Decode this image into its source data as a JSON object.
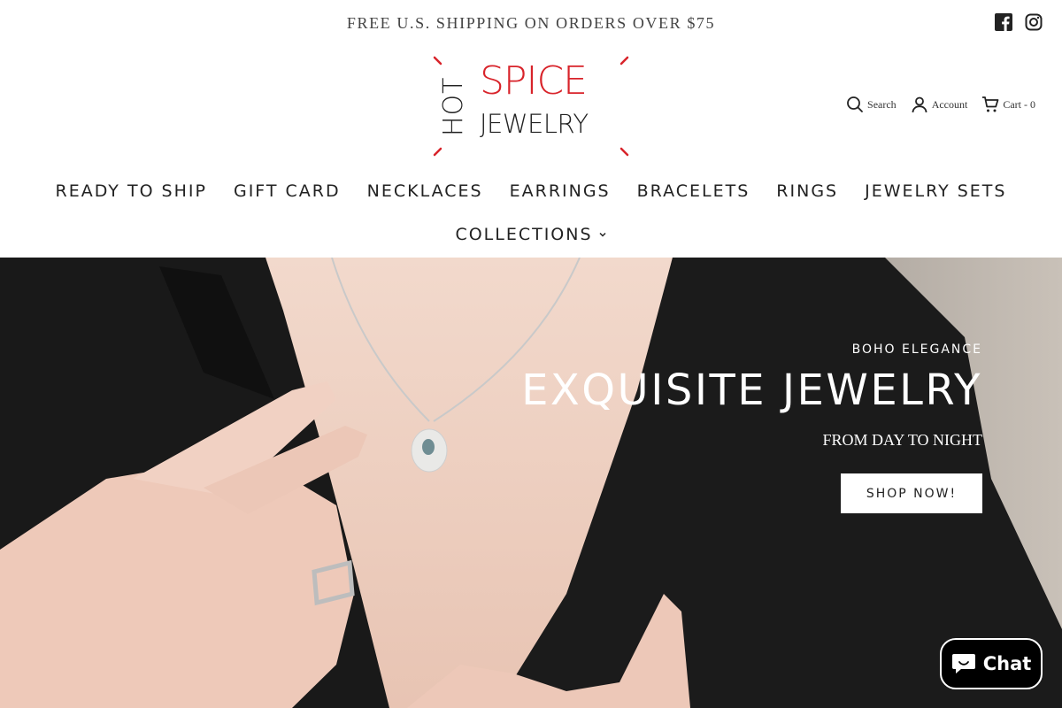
{
  "announcement": {
    "text": "FREE U.S. SHIPPING ON ORDERS OVER $75"
  },
  "social": {
    "facebook_icon": "facebook-icon",
    "instagram_icon": "instagram-icon"
  },
  "logo": {
    "hot": "HOT",
    "spice": "SPICE",
    "jewelry": "JEWELRY",
    "accent_color": "#d8232a"
  },
  "header": {
    "search_label": "Search",
    "account_label": "Account",
    "cart_label": "Cart - 0"
  },
  "nav": {
    "items": [
      "READY TO SHIP",
      "GIFT CARD",
      "NECKLACES",
      "EARRINGS",
      "BRACELETS",
      "RINGS",
      "JEWELRY SETS"
    ],
    "collections_label": "COLLECTIONS"
  },
  "hero": {
    "subtitle": "BOHO ELEGANCE",
    "title": "EXQUISITE JEWELRY",
    "tagline": "FROM DAY TO NIGHT",
    "cta_label": "SHOP NOW!"
  },
  "chat": {
    "label": "Chat"
  }
}
